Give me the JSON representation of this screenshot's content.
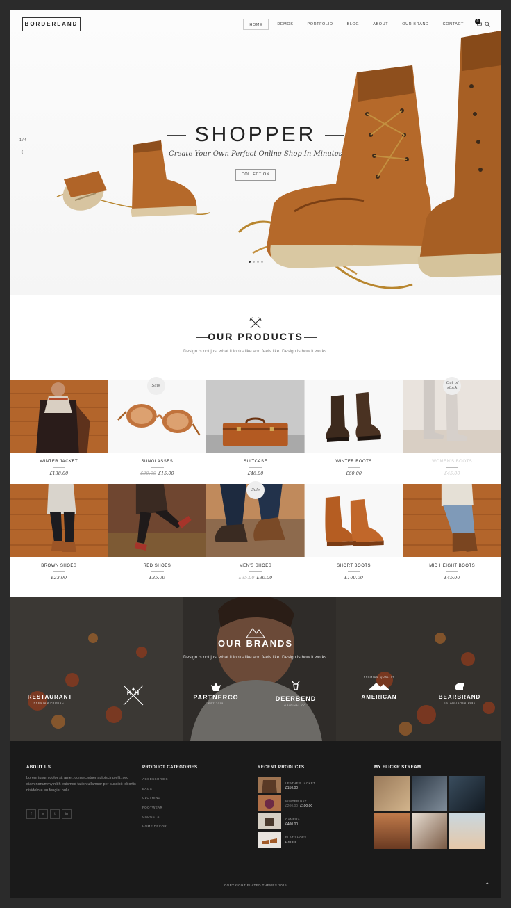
{
  "header": {
    "logo": "BORDERLAND",
    "nav": [
      "HOME",
      "DEMOS",
      "PORTFOLIO",
      "BLOG",
      "ABOUT",
      "OUR BRAND",
      "CONTACT"
    ],
    "cart_count": "0"
  },
  "hero": {
    "title": "SHOPPER",
    "subtitle": "Create Your Own Perfect Online Shop In Minutes",
    "button": "COLLECTION",
    "counter": "1 / 4",
    "active_slide": 1,
    "slide_count": 4
  },
  "products": {
    "title": "OUR PRODUCTS",
    "subtitle": "Design is not just what it looks like and feels like. Design is how it works.",
    "items": [
      {
        "name": "WINTER JACKET",
        "price": "£138.00",
        "old_price": "",
        "badge": ""
      },
      {
        "name": "SUNGLASSES",
        "price": "£15.00",
        "old_price": "£30.00",
        "badge": "Sale"
      },
      {
        "name": "SUITCASE",
        "price": "£46.00",
        "old_price": "",
        "badge": ""
      },
      {
        "name": "WINTER BOOTS",
        "price": "£60.00",
        "old_price": "",
        "badge": ""
      },
      {
        "name": "WOMEN'S BOOTS",
        "price": "£45.00",
        "old_price": "",
        "badge": "Out of stock"
      },
      {
        "name": "BROWN SHOES",
        "price": "£23.00",
        "old_price": "",
        "badge": ""
      },
      {
        "name": "RED SHOES",
        "price": "£35.00",
        "old_price": "",
        "badge": ""
      },
      {
        "name": "MEN'S SHOES",
        "price": "£30.00",
        "old_price": "£35.00",
        "badge": "Sale"
      },
      {
        "name": "SHORT BOOTS",
        "price": "£100.00",
        "old_price": "",
        "badge": ""
      },
      {
        "name": "MID HEIGHT BOOTS",
        "price": "£45.00",
        "old_price": "",
        "badge": ""
      }
    ]
  },
  "brands": {
    "title": "OUR BRANDS",
    "subtitle": "Design is not just what it looks like and feels like. Design is how it works.",
    "logos": [
      {
        "name": "RESTAURANT",
        "sub": "PREMIUM PRODUCT"
      },
      {
        "name": "H H",
        "sub": ""
      },
      {
        "name": "PARTNERCO",
        "sub": "EST 2015"
      },
      {
        "name": "DEERBEND",
        "sub": "ORIGINAL CO."
      },
      {
        "name": "AMERICAN",
        "sub": "PREMIUM QUALITY"
      },
      {
        "name": "BEARBRAND",
        "sub": "ESTABLISHED 1951"
      }
    ]
  },
  "footer": {
    "about_title": "ABOUT US",
    "about_text": "Lorem ipsum dolor sit amet, consectetuer adipiscing elit, sed diam nonummy nibh euismod tation ullamcor per suscipit lobortis nisidolore eu feugiat nulla.",
    "social": [
      "f",
      "v",
      "t",
      "in"
    ],
    "categories_title": "PRODUCT CATEGORIES",
    "categories": [
      "ACCESSORIES",
      "BAGS",
      "CLOTHING",
      "FOOTWEAR",
      "GADGETS",
      "HOME DECOR"
    ],
    "recent_title": "RECENT PRODUCTS",
    "recent": [
      {
        "name": "LEATHER JACKET",
        "price": "£150.00",
        "old_price": ""
      },
      {
        "name": "WINTER HAT",
        "price": "£100.00",
        "old_price": "£200.00"
      },
      {
        "name": "CAMERA",
        "price": "£400.00",
        "old_price": ""
      },
      {
        "name": "FLAT SHOES",
        "price": "£70.00",
        "old_price": ""
      }
    ],
    "flickr_title": "MY FLICKR STREAM",
    "copyright": "COPYRIGHT ELATED THEMES 2015"
  }
}
